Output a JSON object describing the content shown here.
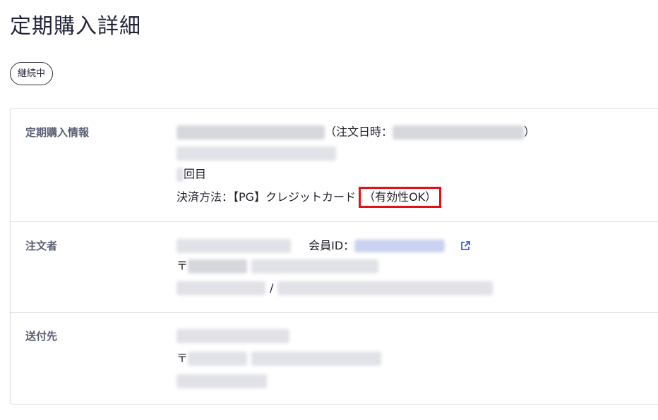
{
  "page": {
    "title": "定期購入詳細",
    "status": "継続中"
  },
  "subscription": {
    "label": "定期購入情報",
    "order_date_prefix": "（注文日時：",
    "order_date_suffix": "）",
    "count_suffix": "回目",
    "payment_label": "決済方法：【PG】クレジットカード",
    "validity": "（有効性OK）"
  },
  "orderer": {
    "label": "注文者",
    "member_id_label": "会員ID：",
    "postal_prefix": "〒",
    "separator": "/",
    "icon": "external-link-icon"
  },
  "shipping": {
    "label": "送付先",
    "postal_prefix": "〒"
  },
  "colors": {
    "highlight": "#e3101a",
    "link": "#3b5bdb"
  }
}
